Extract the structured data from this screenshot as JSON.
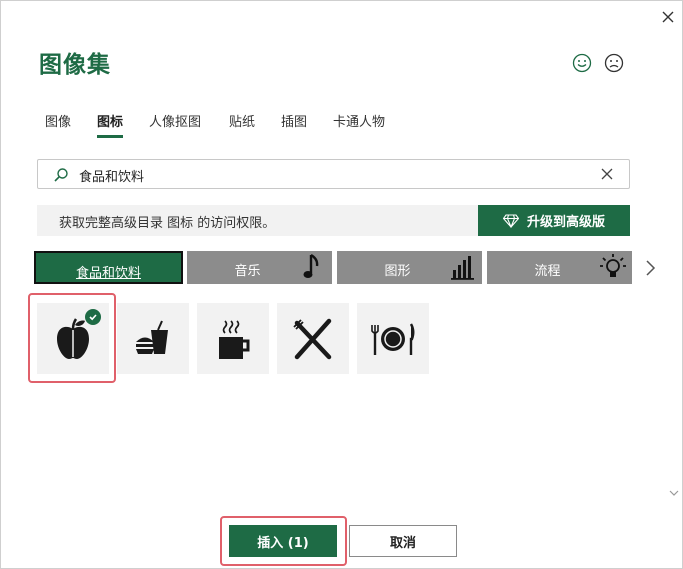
{
  "dialog": {
    "title": "图像集"
  },
  "tabs": [
    {
      "label": "图像"
    },
    {
      "label": "图标"
    },
    {
      "label": "人像抠图"
    },
    {
      "label": "贴纸"
    },
    {
      "label": "插图"
    },
    {
      "label": "卡通人物"
    }
  ],
  "active_tab": "图标",
  "search": {
    "value": "食品和饮料"
  },
  "upsell": {
    "text": "获取完整高级目录 图标 的访问权限。",
    "button_label": "升级到高级版"
  },
  "categories": [
    {
      "label": "食品和饮料",
      "icon": "none"
    },
    {
      "label": "音乐",
      "icon": "music-note-icon"
    },
    {
      "label": "图形",
      "icon": "bar-chart-icon"
    },
    {
      "label": "流程",
      "icon": "lightbulb-icon"
    }
  ],
  "active_category": "食品和饮料",
  "icons": [
    {
      "name": "apple-icon",
      "selected": true
    },
    {
      "name": "burger-drink-icon",
      "selected": false
    },
    {
      "name": "coffee-cup-icon",
      "selected": false
    },
    {
      "name": "fork-knife-icon",
      "selected": false
    },
    {
      "name": "plate-setting-icon",
      "selected": false
    }
  ],
  "buttons": {
    "insert_label": "插入 (1)",
    "cancel_label": "取消"
  },
  "colors": {
    "accent": "#1e6b45",
    "highlight": "#e0606a",
    "category_bg": "#8c8c8c",
    "tile_bg": "#f2f2f2"
  }
}
